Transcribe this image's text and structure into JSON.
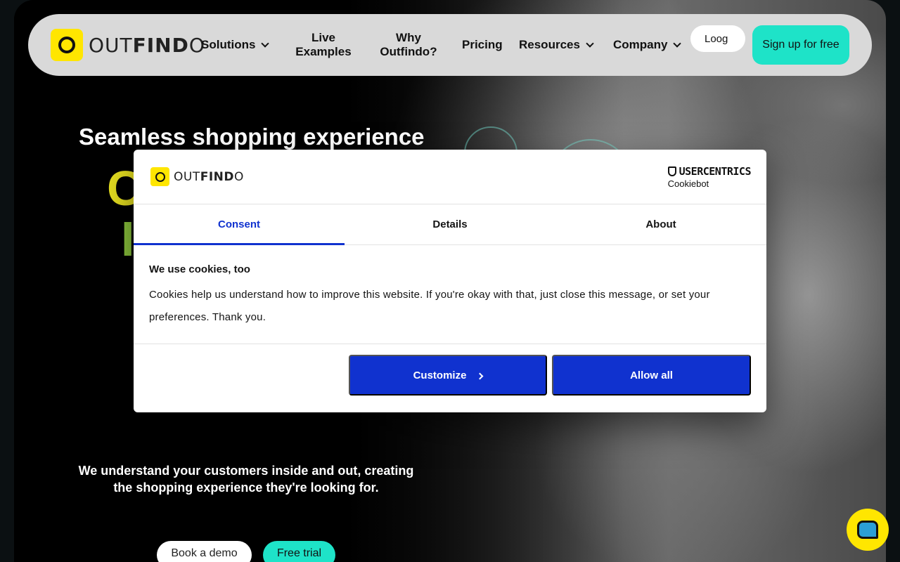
{
  "brand": {
    "logo_light": "OUT",
    "logo_bold": "FIND",
    "logo_end": "O"
  },
  "nav": {
    "items": [
      {
        "label": "Solutions",
        "dropdown": true
      },
      {
        "label": "Live\nExamples",
        "dropdown": false
      },
      {
        "label": "Why\nOutfindo?",
        "dropdown": false
      },
      {
        "label": "Pricing",
        "dropdown": false
      },
      {
        "label": "Resources",
        "dropdown": true
      },
      {
        "label": "Company",
        "dropdown": true
      }
    ],
    "login_label": "Loog",
    "signup_label": "Sign up for free"
  },
  "hero": {
    "title": "Seamless shopping experience",
    "big_line1": "C",
    "big_line2": "I",
    "subtitle": "We understand your customers inside and out, creating the shopping experience they're looking for.",
    "demo_label": "Book a demo",
    "trial_label": "Free trial"
  },
  "cookie_modal": {
    "provider_name": "USERCENTRICS",
    "provider_sub": "Cookiebot",
    "tabs": [
      "Consent",
      "Details",
      "About"
    ],
    "active_tab": "Consent",
    "heading": "We use cookies, too",
    "body": "Cookies help us understand how to improve this website. If you're okay with that, just close this message, or set your preferences. Thank you.",
    "customize_label": "Customize",
    "allow_label": "Allow all"
  },
  "colors": {
    "accent_teal": "#1ee3c8",
    "brand_yellow": "#ffe600",
    "cookie_blue": "#1032cf"
  },
  "icons": {
    "chat": "chat-bubble-icon",
    "dropdown": "chevron-down-icon",
    "customize_arrow": "chevron-right-icon",
    "provider": "shield-icon"
  }
}
